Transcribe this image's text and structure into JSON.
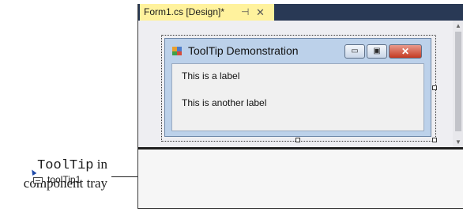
{
  "callout": {
    "code_word": "ToolTip",
    "line1_rest": " in",
    "line2": "component tray"
  },
  "tab": {
    "title": "Form1.cs [Design]*",
    "pin_glyph": "⊣",
    "close_glyph": "✕"
  },
  "form": {
    "title": "ToolTip Demonstration",
    "label1": "This is a label",
    "label2": "This is another label",
    "buttons": {
      "minimize": "▭",
      "maximize": "▣",
      "close": "✕"
    }
  },
  "tray": {
    "item_label": "toolTip1"
  },
  "colors": {
    "tab_active": "#fff29d",
    "tabstrip": "#293955",
    "form_frame": "#bcd1ea",
    "close_button": "#c43a22"
  },
  "icons": {
    "app_icon": "windows-forms-app-icon",
    "tray_icon": "tooltip-component-icon",
    "pin_icon": "pin-icon",
    "tab_close_icon": "close-icon"
  }
}
